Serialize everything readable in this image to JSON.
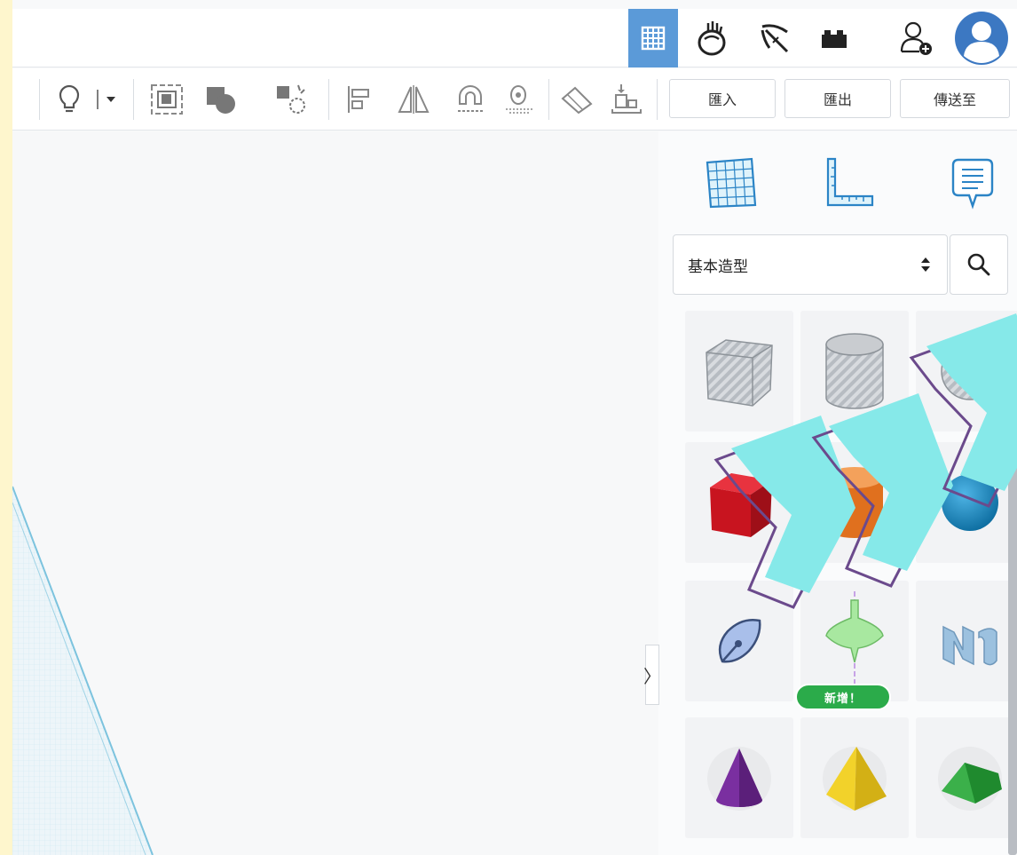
{
  "top_nav": {
    "items": [
      {
        "icon": "3d-design-grid-icon",
        "active": true
      },
      {
        "icon": "circuits-icon",
        "active": false
      },
      {
        "icon": "minecraft-pickaxe-icon",
        "active": false
      },
      {
        "icon": "brick-icon",
        "active": false
      },
      {
        "icon": "add-user-icon",
        "active": false
      },
      {
        "icon": "profile-avatar-icon",
        "active": false
      }
    ],
    "active_color": "#5b9ad8"
  },
  "toolbar": {
    "tools": [
      "lightbulb-icon",
      "dropdown-arrow-icon",
      "group-icon",
      "ungroup-icon",
      "hole-solid-icon",
      "align-icon",
      "mirror-icon",
      "cruise-magnet-icon",
      "workplane-icon",
      "ruler-icon",
      "drop-icon"
    ],
    "import_label": "匯入",
    "export_label": "匯出",
    "send_label": "傳送至"
  },
  "panel": {
    "tools": [
      "workplane-grid-icon",
      "ruler-icon",
      "notes-icon"
    ],
    "category": {
      "value": "基本造型"
    },
    "shapes": [
      {
        "name": "box-hole",
        "color": "#9aa0a6"
      },
      {
        "name": "cylinder-hole",
        "color": "#9aa0a6"
      },
      {
        "name": "sphere-hole",
        "color": "#9aa0a6"
      },
      {
        "name": "box",
        "color": "#d6162a"
      },
      {
        "name": "cylinder",
        "color": "#e8792a"
      },
      {
        "name": "sphere",
        "color": "#1f8dc7"
      },
      {
        "name": "scribble",
        "color": "#7f9ed8"
      },
      {
        "name": "spinning-top",
        "color": "#9fe39f"
      },
      {
        "name": "text-shape",
        "color": "#9cc1df"
      },
      {
        "name": "cone",
        "color": "#7a2fa0"
      },
      {
        "name": "pyramid",
        "color": "#f2d22a"
      },
      {
        "name": "roof",
        "color": "#3bb04a"
      }
    ],
    "new_badge": "新增！"
  },
  "colors": {
    "outer_background": "#fef6cd",
    "accent_blue": "#5b9ad8",
    "overlay_cyan": "#86e9e9",
    "overlay_outline": "#6b4a8c"
  }
}
